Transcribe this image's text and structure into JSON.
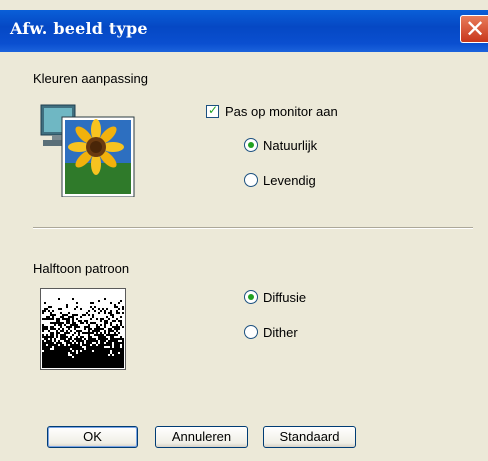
{
  "window": {
    "title": "Afw. beeld type"
  },
  "color_section": {
    "label": "Kleuren aanpassing",
    "checkbox_label": "Pas op monitor aan",
    "checkbox_checked": true,
    "options": [
      {
        "label": "Natuurlijk",
        "selected": true
      },
      {
        "label": "Levendig",
        "selected": false
      }
    ]
  },
  "halftone_section": {
    "label": "Halftoon patroon",
    "options": [
      {
        "label": "Diffusie",
        "selected": true
      },
      {
        "label": "Dither",
        "selected": false
      }
    ]
  },
  "buttons": {
    "ok": "OK",
    "cancel": "Annuleren",
    "default": "Standaard"
  },
  "colors": {
    "titlebar": "#0548c4",
    "face": "#ece9d8",
    "radio_check": "#21a121",
    "close": "#c8361b"
  },
  "icons": [
    "monitor-sunflower-icon",
    "halftone-pattern-icon",
    "close-icon"
  ]
}
